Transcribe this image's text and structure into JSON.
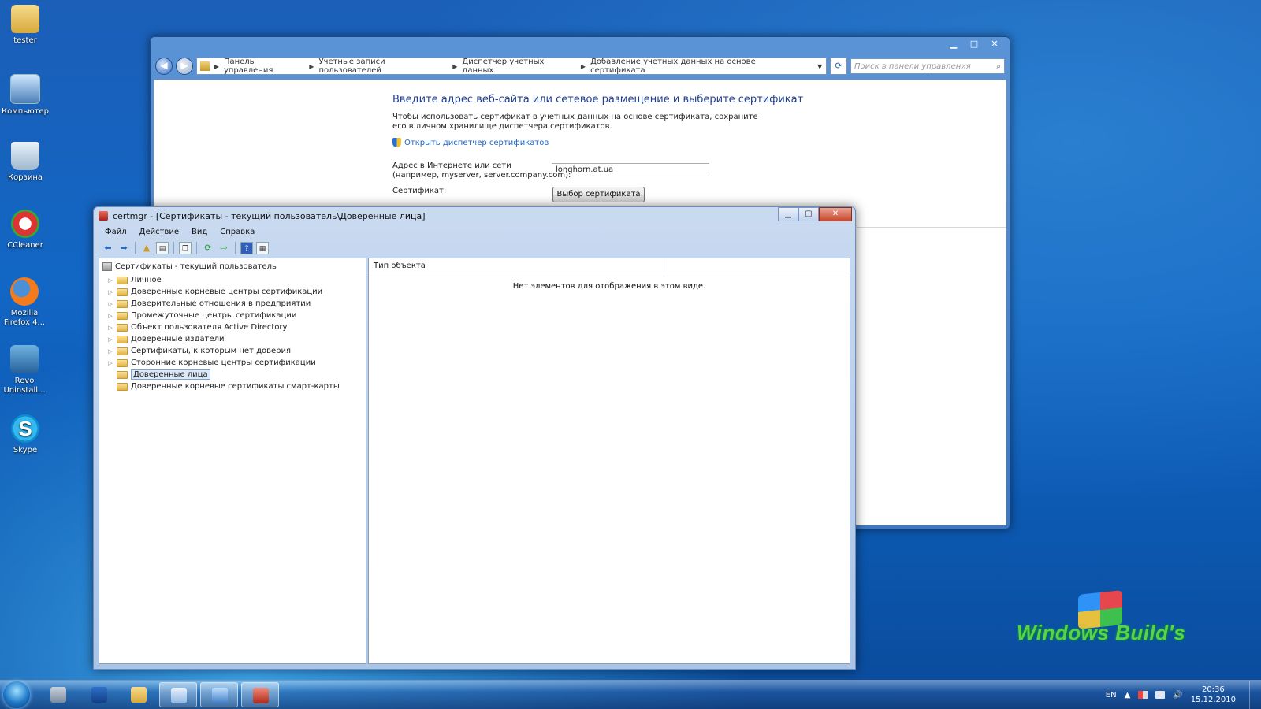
{
  "desktop": {
    "icons": [
      {
        "label": "tester",
        "icon": "user-folder-icon"
      },
      {
        "label": "Компьютер",
        "icon": "computer-icon"
      },
      {
        "label": "Корзина",
        "icon": "recycle-bin-icon"
      },
      {
        "label": "CCleaner",
        "icon": "ccleaner-icon"
      },
      {
        "label": "Mozilla Firefox 4...",
        "icon": "firefox-icon"
      },
      {
        "label": "Revo Uninstall...",
        "icon": "revo-icon"
      },
      {
        "label": "Skype",
        "icon": "skype-icon"
      }
    ],
    "watermark": "Windows Build's"
  },
  "control_panel": {
    "breadcrumbs": [
      "Панель управления",
      "Учетные записи пользователей",
      "Диспетчер учетных данных",
      "Добавление учетных данных на основе сертификата"
    ],
    "search_placeholder": "Поиск в панели управления",
    "heading": "Введите адрес веб-сайта или сетевое размещение и выберите сертификат",
    "description": "Чтобы использовать сертификат в учетных данных на основе сертификата, сохраните его в личном хранилище диспетчера сертификатов.",
    "link": "Открыть диспетчер сертификатов",
    "address_label_line1": "Адрес в Интернете или сети",
    "address_label_line2": "(например, myserver, server.company.com):",
    "address_value": "longhorn.at.ua",
    "certificate_label": "Сертификат:",
    "choose_button": "Выбор сертификата"
  },
  "certmgr": {
    "title": "certmgr - [Сертификаты - текущий пользователь\\Доверенные лица]",
    "menu": [
      "Файл",
      "Действие",
      "Вид",
      "Справка"
    ],
    "tree_root": "Сертификаты - текущий пользователь",
    "tree_items": [
      {
        "label": "Личное",
        "expandable": true,
        "selected": false
      },
      {
        "label": "Доверенные корневые центры сертификации",
        "expandable": true,
        "selected": false
      },
      {
        "label": "Доверительные отношения в предприятии",
        "expandable": true,
        "selected": false
      },
      {
        "label": "Промежуточные центры сертификации",
        "expandable": true,
        "selected": false
      },
      {
        "label": "Объект пользователя Active Directory",
        "expandable": true,
        "selected": false
      },
      {
        "label": "Доверенные издатели",
        "expandable": true,
        "selected": false
      },
      {
        "label": "Сертификаты, к которым нет доверия",
        "expandable": true,
        "selected": false
      },
      {
        "label": "Сторонние корневые центры сертификации",
        "expandable": true,
        "selected": false
      },
      {
        "label": "Доверенные лица",
        "expandable": false,
        "selected": true
      },
      {
        "label": "Доверенные корневые сертификаты смарт-карты",
        "expandable": false,
        "selected": false
      }
    ],
    "column_header": "Тип объекта",
    "empty_message": "Нет элементов для отображения в этом виде."
  },
  "taskbar": {
    "language": "EN",
    "time": "20:36",
    "date": "15.12.2010",
    "buttons": [
      "server-manager-icon",
      "powershell-icon",
      "explorer-icon",
      "paint-icon",
      "control-panel-icon",
      "certmgr-icon"
    ]
  }
}
